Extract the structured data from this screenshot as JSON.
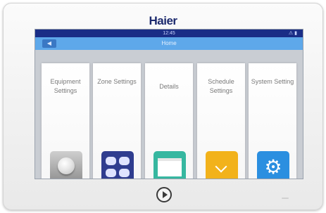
{
  "device": {
    "brand": "Haier"
  },
  "statusbar": {
    "time": "12:45",
    "icons": "⚠ ▮"
  },
  "titlebar": {
    "back_label": "◀",
    "title": "Home"
  },
  "cards": [
    {
      "label": "Equipment Settings",
      "icon": "dome-icon"
    },
    {
      "label": "Zone Settings",
      "icon": "grid-icon"
    },
    {
      "label": "Details",
      "icon": "document-icon"
    },
    {
      "label": "Schedule Settings",
      "icon": "chevron-icon"
    },
    {
      "label": "System Setting",
      "icon": "gear-icon"
    }
  ],
  "colors": {
    "statusbar": "#1a2d86",
    "titlebar": "#5ea8ea",
    "brand": "#1c2a6e",
    "zone": "#2f3d8f",
    "details": "#36b7a0",
    "schedule": "#f2b21b",
    "system": "#2b8fe0"
  }
}
